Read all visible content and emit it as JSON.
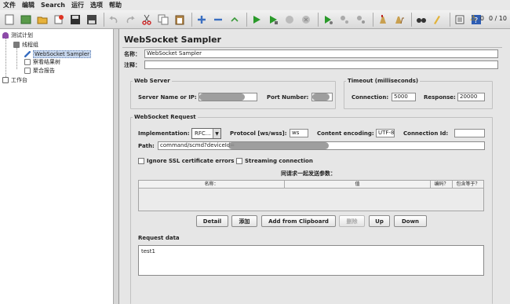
{
  "menu": [
    "文件",
    "编辑",
    "Search",
    "运行",
    "选项",
    "帮助"
  ],
  "toolbar": {
    "icons": [
      "new-icon",
      "templates-icon",
      "open-icon",
      "recent-icon",
      "save-icon",
      "save-as-icon",
      "undo-icon",
      "redo-icon",
      "cut-icon",
      "copy-icon",
      "paste-icon",
      "expand-icon",
      "collapse-icon",
      "toggle-icon",
      "start-icon",
      "start-no-pause-icon",
      "stop-icon",
      "shutdown-icon",
      "remote-start-icon",
      "remote-stop-icon",
      "remote-shutdown-icon",
      "clear-icon",
      "clear-all-icon",
      "search-icon",
      "reset-search-icon",
      "function-helper-icon",
      "help-icon"
    ],
    "warning_count": "0",
    "thread_count": "0 / 10"
  },
  "tree": {
    "root": "测试计划",
    "thread_group": "线程组",
    "sampler": "WebSocket Sampler",
    "listener1": "察看结果树",
    "listener2": "聚合报告",
    "workbench": "工作台"
  },
  "form": {
    "title": "WebSocket Sampler",
    "name_label": "名称：",
    "name_value": "WebSocket Sampler",
    "comment_label": "注释：",
    "comment_value": "",
    "web_server_group": "Web Server",
    "server_label": "Server Name or IP:",
    "port_label": "Port Number:",
    "timeout_group": "Timeout (milliseconds)",
    "connection_label": "Connection:",
    "connection_value": "5000",
    "response_label": "Response:",
    "response_value": "20000",
    "request_group": "WebSocket Request",
    "impl_label": "Implementation:",
    "impl_value": "RFC...",
    "protocol_label": "Protocol [ws/wss]:",
    "protocol_value": "ws",
    "encoding_label": "Content encoding:",
    "encoding_value": "UTF-8",
    "conn_id_label": "Connection Id:",
    "conn_id_value": "",
    "path_label": "Path:",
    "path_value": "command/scmd?deviceId=",
    "ignore_ssl": "Ignore SSL certificate errors",
    "streaming": "Streaming connection",
    "params_title": "同请求一起发送参数：",
    "col_name": "名称：",
    "col_value": "值",
    "col_encode": "编码？",
    "col_equals": "包含等于？",
    "btn_detail": "Detail",
    "btn_add": "添加",
    "btn_clipboard": "Add from Clipboard",
    "btn_delete": "删除",
    "btn_up": "Up",
    "btn_down": "Down",
    "request_data_label": "Request data",
    "request_data_value": "test1"
  }
}
